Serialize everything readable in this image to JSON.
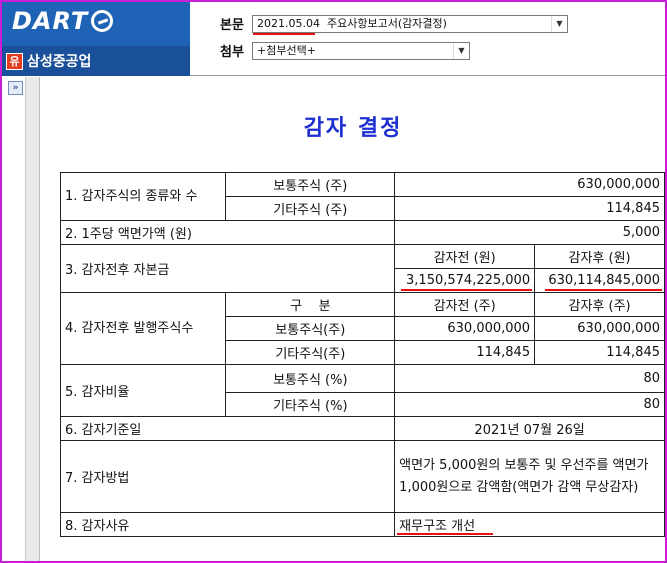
{
  "brand": {
    "logo_text": "DART",
    "company_name": "삼성중공업",
    "company_icon": "유"
  },
  "header": {
    "main_label": "본문",
    "main_select_value": "2021.05.04  주요사항보고서(감자결정)",
    "attach_label": "첨부",
    "attach_select_value": "+첨부선택+",
    "expand_icon_text": "»"
  },
  "document": {
    "title": "감자 결정",
    "rows": {
      "r1_label": "1. 감자주식의 종류와 수",
      "r1_common": "보통주식 (주)",
      "r1_common_value": "630,000,000",
      "r1_other": "기타주식 (주)",
      "r1_other_value": "114,845",
      "r2_label": "2. 1주당 액면가액 (원)",
      "r2_value": "5,000",
      "r3_label": "3. 감자전후 자본금",
      "r3_before_head": "감자전 (원)",
      "r3_after_head": "감자후 (원)",
      "r3_before_value": "3,150,574,225,000",
      "r3_after_value": "630,114,845,000",
      "r4_label": "4. 감자전후 발행주식수",
      "r4_division": "구    분",
      "r4_before_head": "감자전 (주)",
      "r4_after_head": "감자후 (주)",
      "r4_common": "보통주식(주)",
      "r4_common_before": "630,000,000",
      "r4_common_after": "630,000,000",
      "r4_other": "기타주식(주)",
      "r4_other_before": "114,845",
      "r4_other_after": "114,845",
      "r5_label": "5. 감자비율",
      "r5_common": "보통주식 (%)",
      "r5_common_value": "80",
      "r5_other": "기타주식 (%)",
      "r5_other_value": "80",
      "r6_label": "6. 감자기준일",
      "r6_value": "2021년 07월 26일",
      "r7_label": "7. 감자방법",
      "r7_value": "액면가 5,000원의 보통주 및 우선주를 액면가 1,000원으로 감액함(액면가 감액 무상감자)",
      "r8_label": "8. 감자사유",
      "r8_value": "재무구조 개선"
    }
  },
  "colors": {
    "title": "#1c2fd1",
    "highlight": "#e81010",
    "logo_bg": "#1e63b6",
    "frame": "#c61fd6"
  }
}
